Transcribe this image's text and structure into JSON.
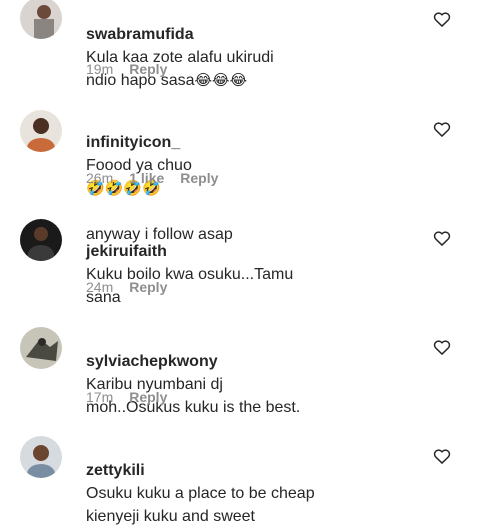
{
  "comments": [
    {
      "username": "swabramufida",
      "text": "Kula kaa zote alafu ukirudi\nndio hapo sasa",
      "emoji": "😂😂😂",
      "time": "19m",
      "likes": "",
      "reply": "Reply"
    },
    {
      "username": "infinityicon_",
      "text": "Foood ya chuo",
      "emoji": "🤣🤣🤣🤣",
      "text2": "anyway i follow asap",
      "time": "26m",
      "likes": "1 like",
      "reply": "Reply"
    },
    {
      "username": "jekiruifaith",
      "text": "Kuku boilo kwa osuku...Tamu\nsana",
      "time": "24m",
      "likes": "",
      "reply": "Reply"
    },
    {
      "username": "sylviachepkwony",
      "text": "Karibu nyumbani dj\nmoh..Osukus kuku is the best.",
      "time": "17m",
      "likes": "",
      "reply": "Reply"
    },
    {
      "username": "zettykili",
      "text": "Osuku kuku a place to be cheap\nkienyeji kuku and sweet",
      "time": "",
      "likes": "",
      "reply": ""
    }
  ]
}
